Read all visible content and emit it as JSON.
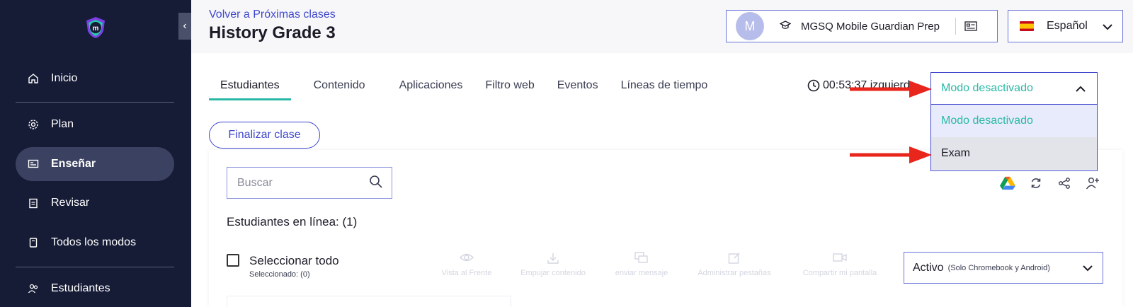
{
  "sidebar": {
    "collapse_glyph": "‹",
    "items": [
      {
        "label": "Inicio",
        "icon": "home-icon"
      },
      {
        "label": "Plan",
        "icon": "gear-icon"
      },
      {
        "label": "Enseñar",
        "icon": "teach-board-icon",
        "active": true
      },
      {
        "label": "Revisar",
        "icon": "clipboard-icon"
      },
      {
        "label": "Todos los modos",
        "icon": "book-icon"
      },
      {
        "label": "Estudiantes",
        "icon": "students-icon"
      }
    ]
  },
  "header": {
    "back_link": "Volver a Próximas clases",
    "title": "History Grade 3",
    "school": {
      "avatar_letter": "M",
      "name": "MGSQ Mobile Guardian Prep"
    },
    "language": {
      "label": "Español",
      "flag": "spain-flag"
    }
  },
  "tabs": [
    {
      "label": "Estudiantes",
      "active": true
    },
    {
      "label": "Contenido"
    },
    {
      "label": "Aplicaciones"
    },
    {
      "label": "Filtro web"
    },
    {
      "label": "Eventos"
    },
    {
      "label": "Líneas de tiempo"
    }
  ],
  "timer": {
    "text": "00:53:37 izquierda"
  },
  "end_class_button": "Finalizar clase",
  "search": {
    "placeholder": "Buscar",
    "value": ""
  },
  "students_online": "Estudiantes en línea: (1)",
  "select_all": {
    "label": "Seleccionar todo",
    "selected": "Seleccionado: (0)"
  },
  "actions": [
    {
      "label": "Vista al Frente",
      "icon": "eye-icon"
    },
    {
      "label": "Empujar contenido",
      "icon": "download-icon"
    },
    {
      "label": "enviar mensaje",
      "icon": "message-icon"
    },
    {
      "label": "Administrar pestañas",
      "icon": "edit-tab-icon"
    },
    {
      "label": "Compartir mi pantalla",
      "icon": "video-icon"
    }
  ],
  "status_filter": {
    "value": "Activo",
    "note": "(Solo Chromebook y Android)"
  },
  "mode_dropdown": {
    "value": "Modo desactivado",
    "options": [
      "Modo desactivado",
      "Exam"
    ]
  },
  "colors": {
    "accent": "#3f48cc",
    "teal": "#2ab8a6",
    "sidebar": "#161b36",
    "annotation_arrow": "#e8261c"
  }
}
